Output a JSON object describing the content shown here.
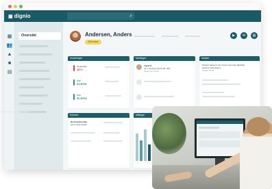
{
  "app": {
    "logo_text": "dignio",
    "colors": {
      "primary": "#1a5a66",
      "accent_badge": "#f4d65a",
      "red": "#e0423c",
      "green": "#2f9a6b"
    }
  },
  "window": {
    "controls": [
      "close",
      "minimize",
      "maximize"
    ]
  },
  "search": {
    "icon": "search-icon"
  },
  "sidebar": {
    "rail_icons": [
      "grid-icon",
      "users-icon",
      "bell-icon",
      "folder-icon",
      "id-card-icon"
    ],
    "active_item": "Oversikt"
  },
  "patient": {
    "name": "Andersen, Anders",
    "badge": "Evt roma"
  },
  "cards": {
    "vitals": {
      "title": "Vurderinger",
      "items": [
        {
          "label": "Temperatur",
          "value": "38°C"
        },
        {
          "label": "Puls",
          "value": "84 BPM"
        },
        {
          "label": "Puls",
          "value": "56 BPM"
        }
      ]
    },
    "messages": {
      "title": "Meldinger",
      "items": [
        {
          "sender": "Ingrid K.",
          "text": "Ja, vi kommer på 14.00. OK?",
          "time": "Innkomne 14:40"
        }
      ]
    },
    "notes": {
      "title": "Notater",
      "text_line1": "Pasient passere mer à time nemende døpfolse",
      "text_line2": "passere vetti skopet.",
      "time": "Trekke 15:04"
    },
    "activities": {
      "title": "Enheter",
      "item_title": "Blodsukkermåler",
      "item_sub": "Accu Chek Guide"
    },
    "measurements": {
      "title": "Målinger"
    }
  }
}
